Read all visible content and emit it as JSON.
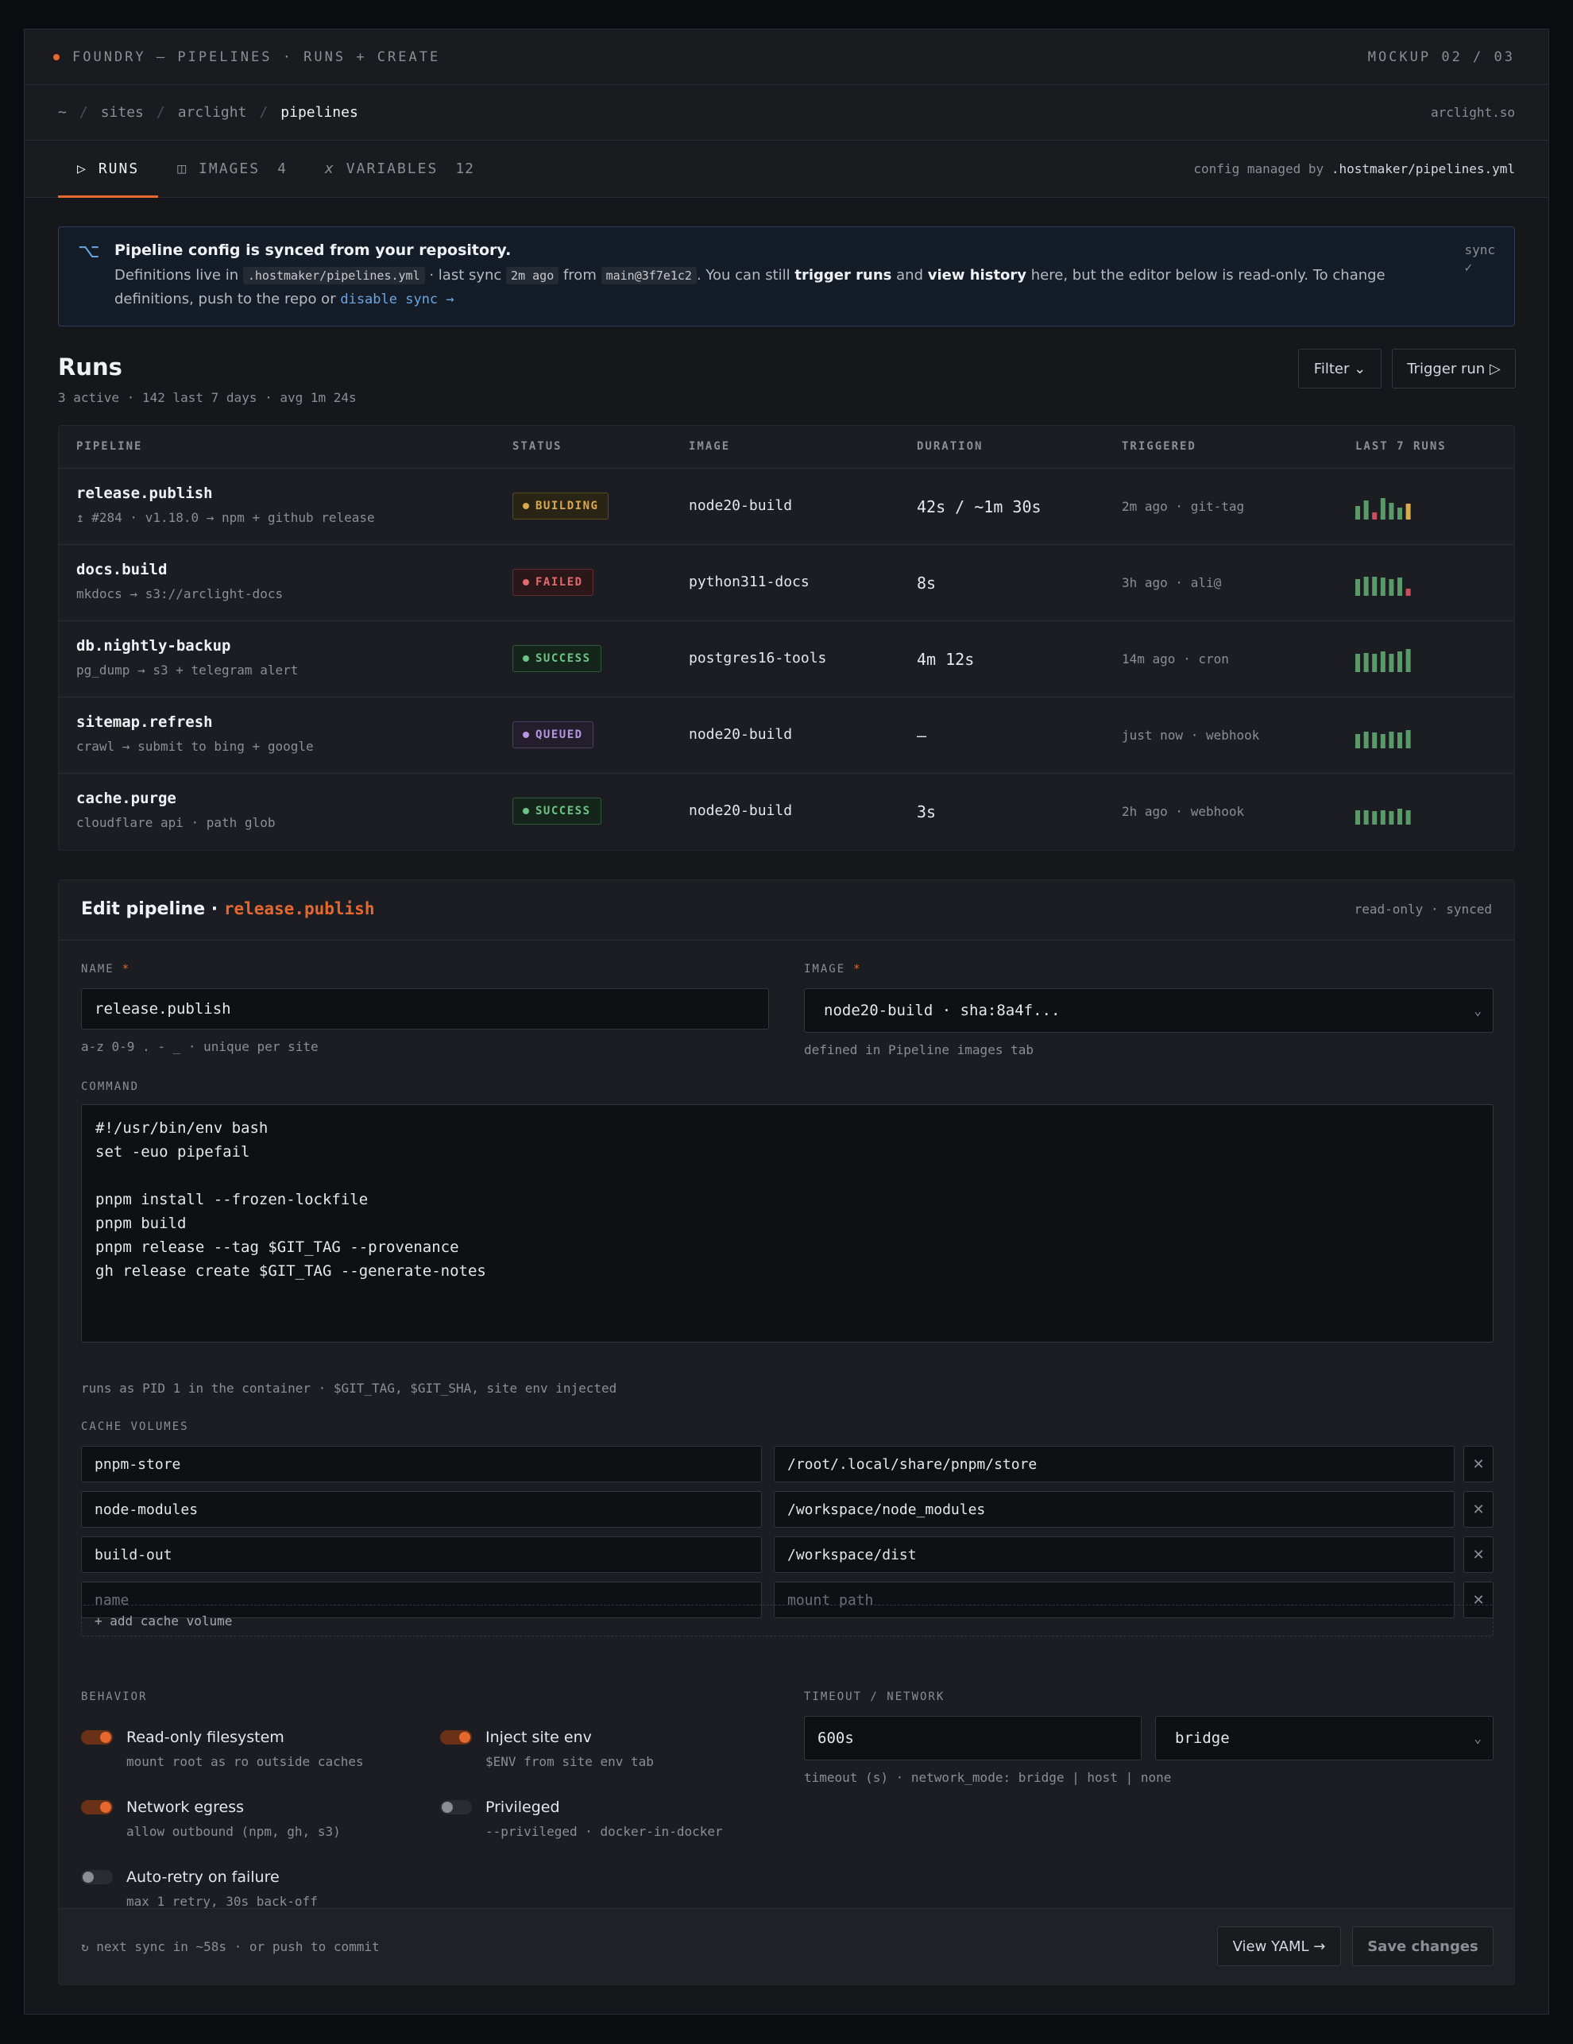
{
  "topbar": {
    "title": "FOUNDRY — PIPELINES · RUNS + CREATE",
    "mockup": "MOCKUP 02 / 03"
  },
  "breadcrumb": {
    "home": "~",
    "items": [
      "sites",
      "arclight",
      "pipelines"
    ],
    "domain": "arclight.so"
  },
  "tabs": [
    {
      "icon": "▷",
      "label": "RUNS",
      "count": ""
    },
    {
      "icon": "◫",
      "label": "IMAGES",
      "count": "4"
    },
    {
      "icon": "x",
      "label": "VARIABLES",
      "count": "12"
    }
  ],
  "config_note": {
    "prefix": "config managed by",
    "path": ".hostmaker/pipelines.yml"
  },
  "banner": {
    "heading": "Pipeline config is synced from your repository.",
    "t1": "Definitions live in",
    "path": ".hostmaker/pipelines.yml",
    "t2": "· last sync",
    "ago": "2m ago",
    "t3": "from",
    "ref": "main@3f7e1c2",
    "t4": ". You can still",
    "b1": "trigger runs",
    "t5": "and",
    "b2": "view history",
    "t6": "here, but the editor below is read-only. To change definitions, push to the repo or",
    "link": "disable sync →",
    "sync": "sync",
    "check": "✓"
  },
  "runs": {
    "title": "Runs",
    "summary": "3 active · 142 last 7 days · avg 1m 24s",
    "filter_label": "Filter ⌄",
    "trigger_label": "Trigger run ▷",
    "columns": [
      "PIPELINE",
      "STATUS",
      "IMAGE",
      "DURATION",
      "TRIGGERED",
      "LAST 7 RUNS"
    ],
    "rows": [
      {
        "name": "release.publish",
        "desc": "↥ #284 · v1.18.0 → npm + github release",
        "status": "BUILDING",
        "image": "node20-build",
        "duration": "42s / ~1m 30s",
        "triggered": "2m ago · git-tag",
        "last7": [
          {
            "h": 0.55,
            "c": "#5a9a68"
          },
          {
            "h": 0.8,
            "c": "#5a9a68"
          },
          {
            "h": 0.3,
            "c": "#c9505a"
          },
          {
            "h": 0.9,
            "c": "#5a9a68"
          },
          {
            "h": 0.7,
            "c": "#5a9a68"
          },
          {
            "h": 0.5,
            "c": "#5a9a68"
          },
          {
            "h": 0.65,
            "c": "#d8a94e"
          }
        ]
      },
      {
        "name": "docs.build",
        "desc": "mkdocs → s3://arclight-docs",
        "status": "FAILED",
        "image": "python311-docs",
        "duration": "8s",
        "triggered": "3h ago · ali@",
        "last7": [
          {
            "h": 0.7,
            "c": "#5a9a68"
          },
          {
            "h": 0.8,
            "c": "#5a9a68"
          },
          {
            "h": 0.8,
            "c": "#5a9a68"
          },
          {
            "h": 0.75,
            "c": "#5a9a68"
          },
          {
            "h": 0.7,
            "c": "#5a9a68"
          },
          {
            "h": 0.75,
            "c": "#5a9a68"
          },
          {
            "h": 0.3,
            "c": "#c9505a"
          }
        ]
      },
      {
        "name": "db.nightly-backup",
        "desc": "pg_dump → s3 + telegram alert",
        "status": "SUCCESS",
        "image": "postgres16-tools",
        "duration": "4m 12s",
        "triggered": "14m ago · cron",
        "last7": [
          {
            "h": 0.75,
            "c": "#5a9a68"
          },
          {
            "h": 0.8,
            "c": "#5a9a68"
          },
          {
            "h": 0.75,
            "c": "#5a9a68"
          },
          {
            "h": 0.85,
            "c": "#5a9a68"
          },
          {
            "h": 0.75,
            "c": "#5a9a68"
          },
          {
            "h": 0.85,
            "c": "#5a9a68"
          },
          {
            "h": 0.95,
            "c": "#5a9a68"
          }
        ]
      },
      {
        "name": "sitemap.refresh",
        "desc": "crawl → submit to bing + google",
        "status": "QUEUED",
        "image": "node20-build",
        "duration": "—",
        "triggered": "just now · webhook",
        "last7": [
          {
            "h": 0.6,
            "c": "#5a9a68"
          },
          {
            "h": 0.7,
            "c": "#5a9a68"
          },
          {
            "h": 0.65,
            "c": "#5a9a68"
          },
          {
            "h": 0.6,
            "c": "#5a9a68"
          },
          {
            "h": 0.7,
            "c": "#5a9a68"
          },
          {
            "h": 0.65,
            "c": "#5a9a68"
          },
          {
            "h": 0.75,
            "c": "#5a9a68"
          }
        ]
      },
      {
        "name": "cache.purge",
        "desc": "cloudflare api · path glob",
        "status": "SUCCESS",
        "image": "node20-build",
        "duration": "3s",
        "triggered": "2h ago · webhook",
        "last7": [
          {
            "h": 0.6,
            "c": "#5a9a68"
          },
          {
            "h": 0.6,
            "c": "#5a9a68"
          },
          {
            "h": 0.55,
            "c": "#5a9a68"
          },
          {
            "h": 0.6,
            "c": "#5a9a68"
          },
          {
            "h": 0.55,
            "c": "#5a9a68"
          },
          {
            "h": 0.65,
            "c": "#5a9a68"
          },
          {
            "h": 0.6,
            "c": "#5a9a68"
          }
        ]
      }
    ]
  },
  "editor": {
    "title": "Edit pipeline ·",
    "pipeline": "release.publish",
    "state": "read-only · synced",
    "name_label": "NAME",
    "name_value": "release.publish",
    "name_hint": "a-z 0-9 . - _ · unique per site",
    "image_label": "IMAGE",
    "image_value": "node20-build · sha:8a4f...",
    "image_hint": "defined in Pipeline images tab",
    "command_label": "COMMAND",
    "command": "#!/usr/bin/env bash\nset -euo pipefail\n\npnpm install --frozen-lockfile\npnpm build\npnpm release --tag $GIT_TAG --provenance\ngh release create $GIT_TAG --generate-notes",
    "command_hint": "runs as PID 1 in the container · $GIT_TAG, $GIT_SHA, site env injected",
    "cache_label": "CACHE VOLUMES",
    "volumes": [
      {
        "name": "pnpm-store",
        "path": "/root/.local/share/pnpm/store"
      },
      {
        "name": "node-modules",
        "path": "/workspace/node_modules"
      },
      {
        "name": "build-out",
        "path": "/workspace/dist"
      }
    ],
    "vol_name_placeholder": "name",
    "vol_path_placeholder": "mount path",
    "remove_glyph": "✕",
    "add_volume": "+ add cache volume",
    "behavior_label": "BEHAVIOR",
    "behaviors": [
      {
        "title": "Read-only filesystem",
        "desc": "mount root as ro outside caches",
        "on": true
      },
      {
        "title": "Inject site env",
        "desc": "$ENV from site env tab",
        "on": true
      },
      {
        "title": "Network egress",
        "desc": "allow outbound (npm, gh, s3)",
        "on": true
      },
      {
        "title": "Privileged",
        "desc": "--privileged · docker-in-docker",
        "on": false
      },
      {
        "title": "Auto-retry on failure",
        "desc": "max 1 retry, 30s back-off",
        "on": false
      }
    ],
    "timeout_label": "TIMEOUT / NETWORK",
    "timeout_value": "600s",
    "network_value": "bridge",
    "timeout_hint": "timeout (s) · network_mode: bridge | host | none",
    "footer_note": "↻ next sync in ~58s · or push to commit",
    "view_yaml": "View YAML →",
    "save": "Save changes"
  },
  "colors": {
    "accent": "#e5682f",
    "success": "#6cc485",
    "failed": "#e26a6f",
    "building": "#d8a94e",
    "queued": "#b796e4",
    "link": "#6aa6e0"
  }
}
